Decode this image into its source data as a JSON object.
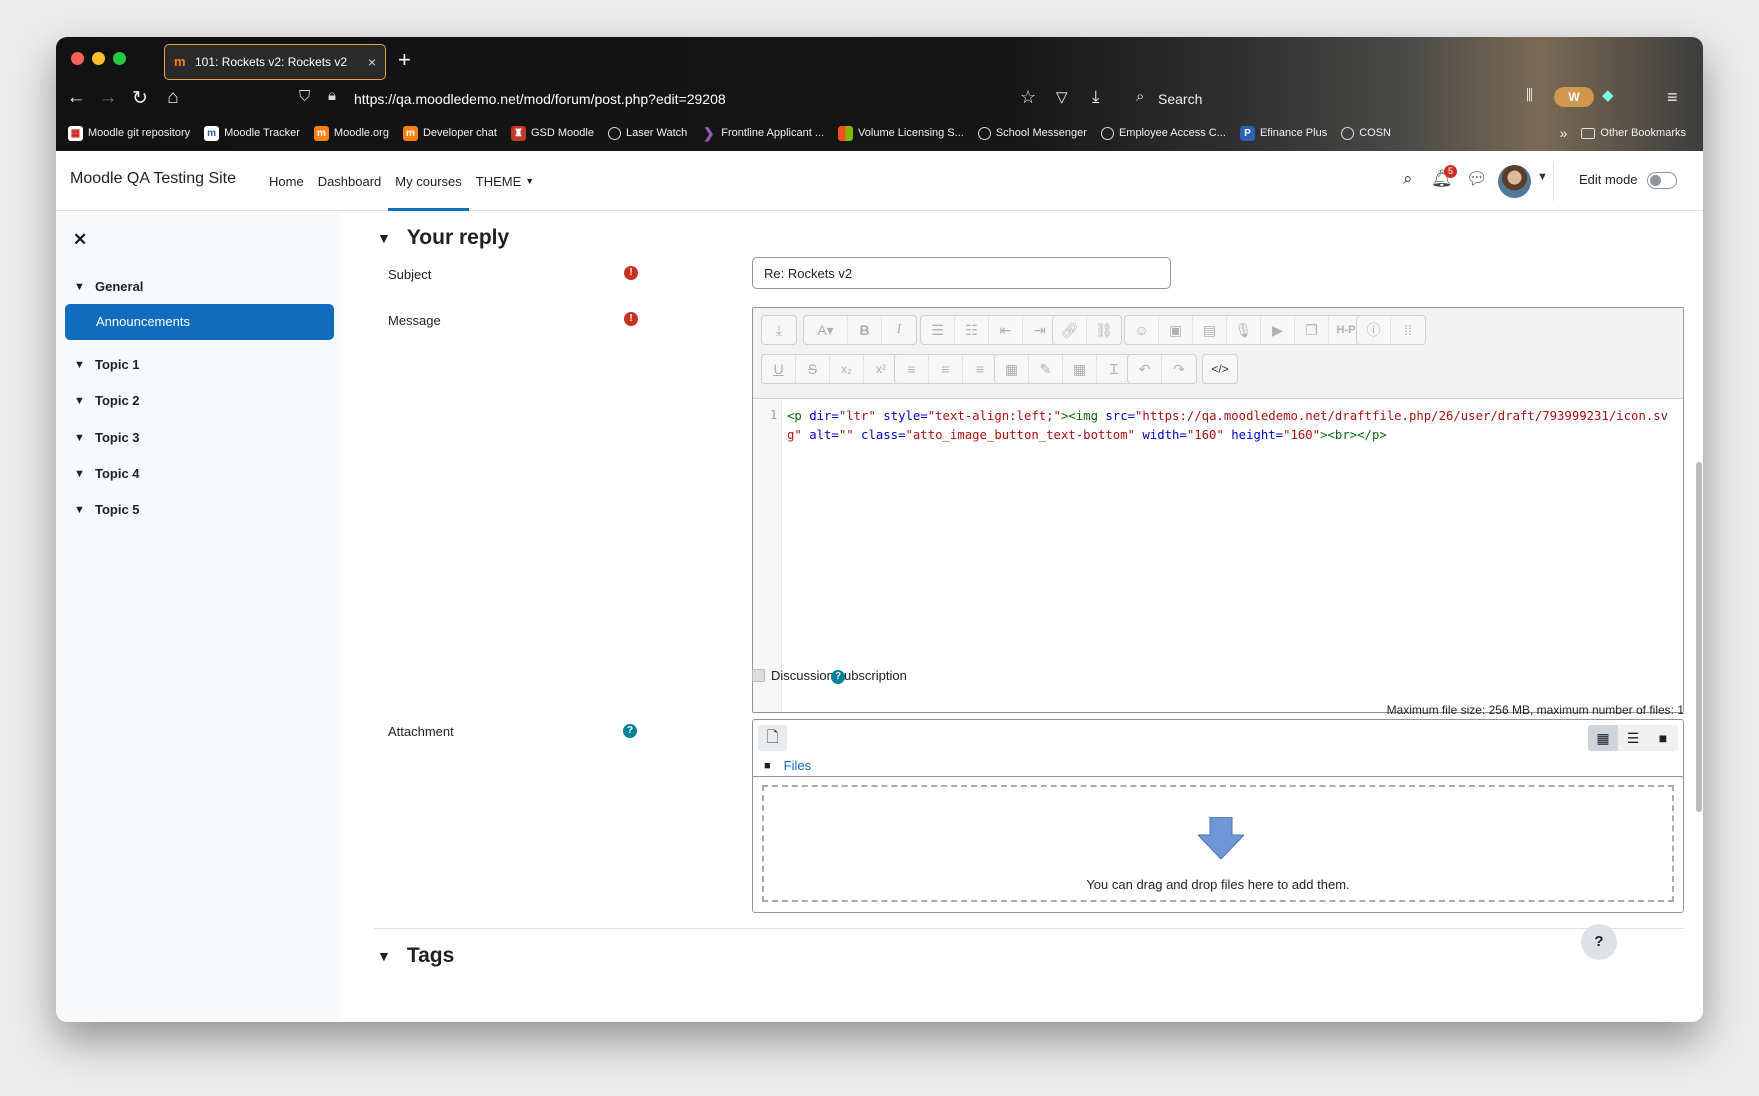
{
  "browser": {
    "tab_title": "101: Rockets v2: Rockets v2",
    "tab_close": "×",
    "url": "https://qa.moodledemo.net/mod/forum/post.php?edit=29208",
    "search_label": "Search",
    "bookmarks": [
      {
        "label": "Moodle git repository",
        "icon": "git-icon"
      },
      {
        "label": "Moodle Tracker",
        "icon": "tracker-icon"
      },
      {
        "label": "Moodle.org",
        "icon": "moodle-icon"
      },
      {
        "label": "Developer chat",
        "icon": "moodle-icon"
      },
      {
        "label": "GSD Moodle",
        "icon": "gsd-icon"
      },
      {
        "label": "Laser Watch",
        "icon": "globe-icon"
      },
      {
        "label": "Frontline Applicant ...",
        "icon": "frontline-icon"
      },
      {
        "label": "Volume Licensing S...",
        "icon": "microsoft-icon"
      },
      {
        "label": "School Messenger",
        "icon": "globe-icon"
      },
      {
        "label": "Employee Access C...",
        "icon": "globe-icon"
      },
      {
        "label": "Efinance Plus",
        "icon": "efinance-icon"
      },
      {
        "label": "COSN",
        "icon": "globe-icon"
      }
    ],
    "other_bookmarks": "Other Bookmarks"
  },
  "navbar": {
    "site_name": "Moodle QA Testing Site",
    "links": [
      "Home",
      "Dashboard",
      "My courses",
      "THEME"
    ],
    "active_link": "My courses",
    "notification_count": "5",
    "edit_mode_label": "Edit mode",
    "edit_mode_on": false
  },
  "course_index": {
    "general": "General",
    "active_item": "Announcements",
    "topics": [
      "Topic 1",
      "Topic 2",
      "Topic 3",
      "Topic 4",
      "Topic 5"
    ]
  },
  "form": {
    "section_title": "Your reply",
    "subject_label": "Subject",
    "subject_value": "Re: Rockets v2",
    "message_label": "Message",
    "editor_line_number": "1",
    "html_code": {
      "p_open": "<p",
      "attr_dir": " dir=",
      "val_dir": "\"ltr\"",
      "attr_style": " style=",
      "val_style": "\"text-align:left;\"",
      "tag_close": ">",
      "img_open": "<img",
      "attr_src": " src=",
      "val_src": "\"https://qa.moodledemo.net/draftfile.php/26/user/draft/793999231/icon.svg\"",
      "attr_alt": " alt=",
      "val_alt": "\"\"",
      "attr_class": " class=",
      "val_class": "\"atto_image_button_text-bottom\"",
      "attr_width": " width=",
      "val_width": "\"160\"",
      "attr_height": " height=",
      "val_height": "\"160\"",
      "tail": "><br></p>"
    },
    "discussion_subscription_label": "Discussion subscription",
    "discussion_subscription_checked": true,
    "attachment_label": "Attachment",
    "max_file_info": "Maximum file size: 256 MB, maximum number of files: 1",
    "files_path": "Files",
    "drop_text": "You can drag and drop files here to add them.",
    "tags_title": "Tags"
  },
  "help_button": "?",
  "colors": {
    "primary": "#0f6cbf",
    "required": "#ca3120",
    "help": "#008196",
    "tab_border": "#e9a23b"
  }
}
